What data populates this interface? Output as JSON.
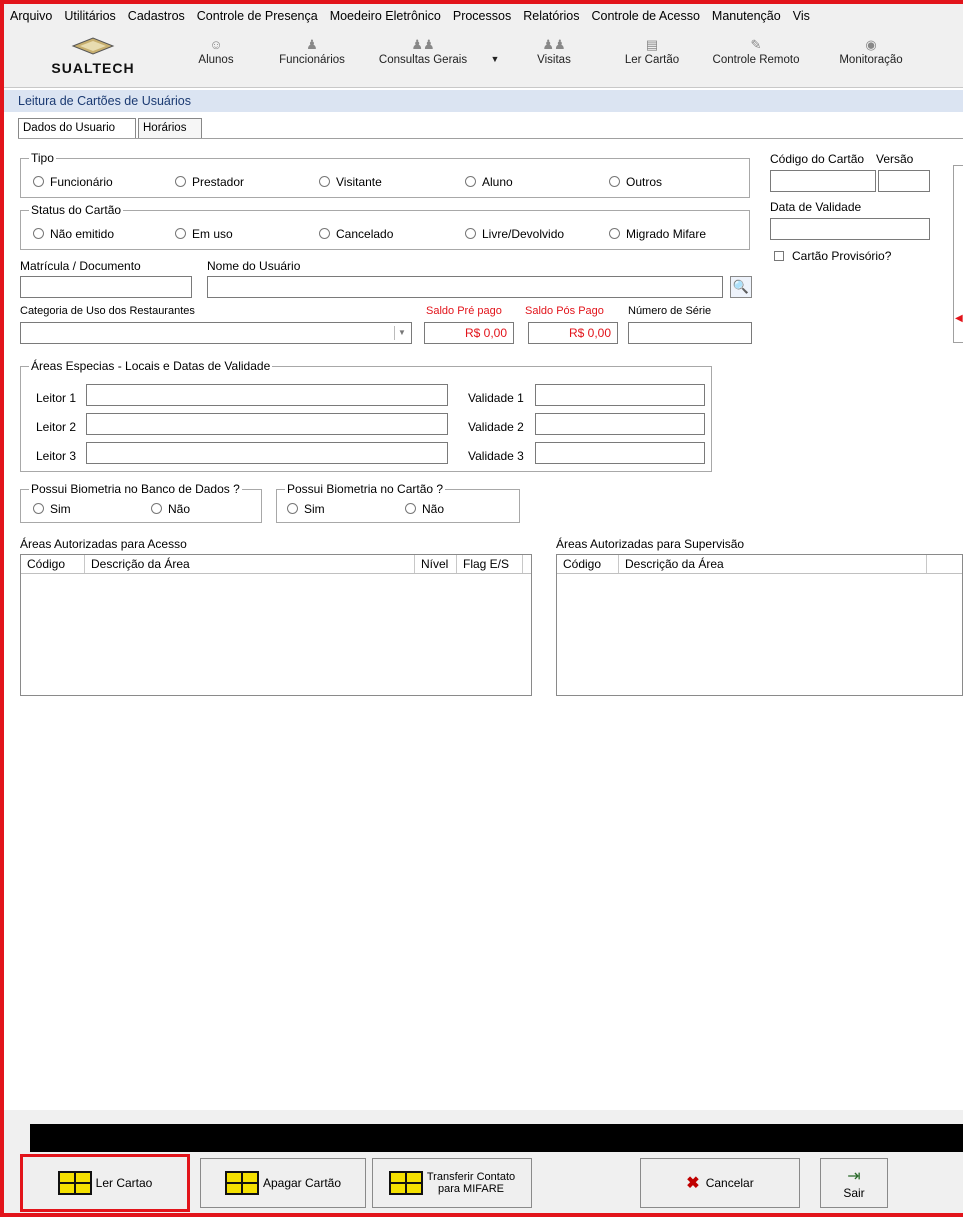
{
  "menu": [
    "Arquivo",
    "Utilitários",
    "Cadastros",
    "Controle de Presença",
    "Moedeiro Eletrônico",
    "Processos",
    "Relatórios",
    "Controle de Acesso",
    "Manutenção",
    "Vis"
  ],
  "logo": "SUALTECH",
  "toolbar": {
    "alunos": "Alunos",
    "funcionarios": "Funcionários",
    "consultas": "Consultas Gerais",
    "visitas": "Visitas",
    "ler_cartao": "Ler Cartão",
    "controle_remoto": "Controle Remoto",
    "monitoracao": "Monitoração"
  },
  "form_title": "Leitura de Cartões de Usuários",
  "tabs": [
    "Dados do Usuario",
    "Horários"
  ],
  "tipo": {
    "label": "Tipo",
    "options": [
      "Funcionário",
      "Prestador",
      "Visitante",
      "Aluno",
      "Outros"
    ]
  },
  "status": {
    "label": "Status do Cartão",
    "options": [
      "Não emitido",
      "Em uso",
      "Cancelado",
      "Livre/Devolvido",
      "Migrado Mifare"
    ]
  },
  "codigo_label": "Código do Cartão",
  "versao_label": "Versão",
  "validade_label": "Data de Validade",
  "provisorio_label": "Cartão Provisório?",
  "matricula_label": "Matrícula / Documento",
  "nome_label": "Nome do Usuário",
  "categoria_label": "Categoria de Uso dos Restaurantes",
  "saldo_pre_label": "Saldo Pré pago",
  "saldo_pos_label": "Saldo Pós Pago",
  "serie_label": "Número de Série",
  "saldo_pre_value": "R$ 0,00",
  "saldo_pos_value": "R$ 0,00",
  "areas_especiais": {
    "label": "Áreas Especias - Locais e Datas de Validade",
    "leitores": [
      "Leitor 1",
      "Leitor 2",
      "Leitor 3"
    ],
    "validades": [
      "Validade 1",
      "Validade 2",
      "Validade 3"
    ]
  },
  "bio_banco": {
    "label": "Possui Biometria no Banco de Dados ?",
    "sim": "Sim",
    "nao": "Não"
  },
  "bio_cartao": {
    "label": "Possui Biometria no Cartão ?",
    "sim": "Sim",
    "nao": "Não"
  },
  "acesso": {
    "label": "Áreas Autorizadas para Acesso",
    "columns": [
      "Código",
      "Descrição da Área",
      "Nível",
      "Flag E/S"
    ]
  },
  "supervisao": {
    "label": "Áreas Autorizadas para Supervisão",
    "columns": [
      "Código",
      "Descrição da Área"
    ]
  },
  "buttons": {
    "ler": "Ler Cartao",
    "apagar": "Apagar Cartão",
    "transferir": "Transferir Contato\npara MIFARE",
    "cancelar": "Cancelar",
    "sair": "Sair"
  },
  "colors": {
    "highlight": "#e2141b",
    "saldo": "#e2141b"
  }
}
